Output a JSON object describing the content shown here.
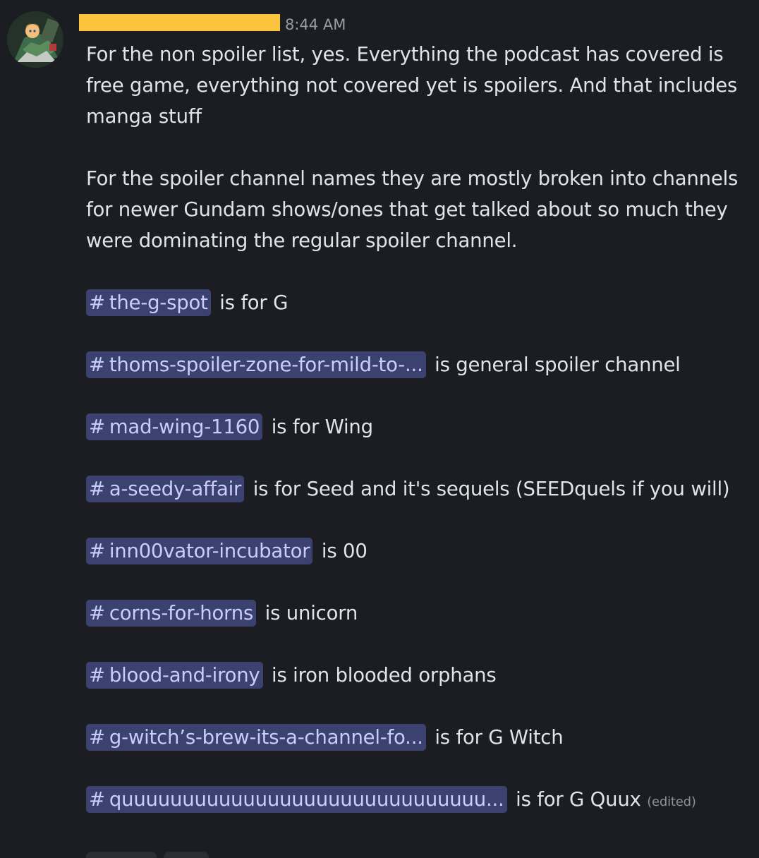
{
  "header": {
    "timestamp": "8:44 AM",
    "redaction_color": "#fcc43c"
  },
  "message": {
    "paragraphs": [
      "For the non spoiler list, yes. Everything the podcast has covered is free game, everything not covered yet is spoilers. And that includes manga stuff",
      "For the spoiler channel names they are mostly broken into channels for newer Gundam shows/ones that get talked about so much they were dominating the regular spoiler channel."
    ],
    "channels": [
      {
        "name": "the-g-spot",
        "desc": "is for G"
      },
      {
        "name": "thoms-spoiler-zone-for-mild-to-...",
        "desc": "is general spoiler channel"
      },
      {
        "name": "mad-wing-1160",
        "desc": "is for Wing"
      },
      {
        "name": "a-seedy-affair",
        "desc": "is for Seed and it's sequels (SEEDquels if you will)"
      },
      {
        "name": "inn00vator-incubator",
        "desc": "is 00"
      },
      {
        "name": "corns-for-horns",
        "desc": "is unicorn"
      },
      {
        "name": "blood-and-irony",
        "desc": "is iron blooded orphans"
      },
      {
        "name": "g-witch’s-brew-its-a-channel-fo...",
        "desc": "is for G Witch"
      },
      {
        "name": "quuuuuuuuuuuuuuuuuuuuuuuuuuuuuu...",
        "desc": "is for G Quux"
      }
    ],
    "hash_symbol": "#",
    "edited_label": "(edited)"
  },
  "colors": {
    "background": "#1c1d22",
    "mention_bg": "#3c4270",
    "mention_text": "#c9cdfb"
  }
}
